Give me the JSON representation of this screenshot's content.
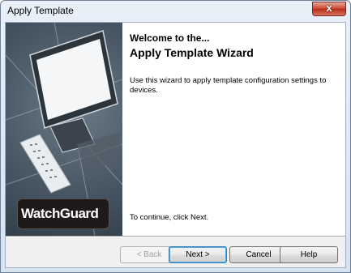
{
  "window": {
    "title": "Apply Template",
    "close_glyph": "x"
  },
  "side_panel": {
    "brand": "WatchGuard"
  },
  "content": {
    "heading_line1": "Welcome to the...",
    "heading_line2": "Apply Template Wizard",
    "description": "Use this wizard to apply template configuration settings to devices.",
    "continue_hint": "To continue, click Next."
  },
  "buttons": {
    "back": {
      "label": "< Back",
      "enabled": false
    },
    "next": {
      "label": "Next >"
    },
    "cancel": {
      "label": "Cancel"
    },
    "help": {
      "label": "Help"
    }
  }
}
